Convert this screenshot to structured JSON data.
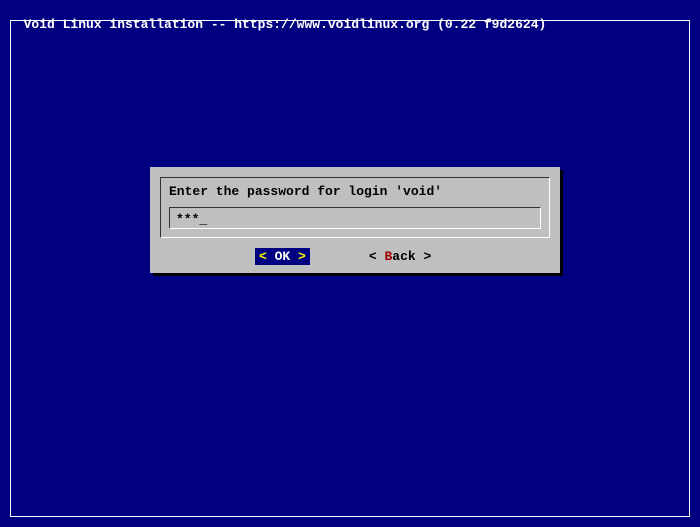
{
  "header": {
    "title": "Void Linux installation -- https://www.voidlinux.org (0.22 f9d2624)"
  },
  "dialog": {
    "prompt": "Enter the password for login 'void'",
    "input_value": "***",
    "cursor": "_",
    "buttons": {
      "ok": {
        "left_bracket": "<",
        "label": " OK ",
        "right_bracket": ">"
      },
      "back": {
        "left_bracket": "< ",
        "hotkey": "B",
        "rest": "ack ",
        "right_bracket": ">"
      }
    }
  }
}
